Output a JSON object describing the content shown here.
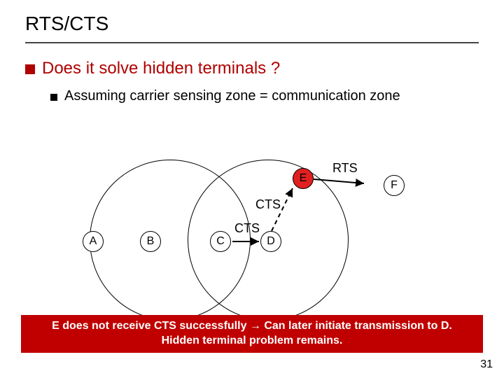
{
  "title": "RTS/CTS",
  "bullet1": "Does it solve hidden terminals ?",
  "bullet2": "Assuming carrier sensing zone = communication zone",
  "nodes": {
    "A": "A",
    "B": "B",
    "C": "C",
    "D": "D",
    "E": "E",
    "F": "F"
  },
  "labels": {
    "rts": "RTS",
    "cts1": "CTS",
    "cts2": "CTS"
  },
  "footer_line1": "E does not receive CTS successfully → Can later initiate transmission to D.",
  "footer_line2": "Hidden terminal problem remains.",
  "page_number": "31"
}
